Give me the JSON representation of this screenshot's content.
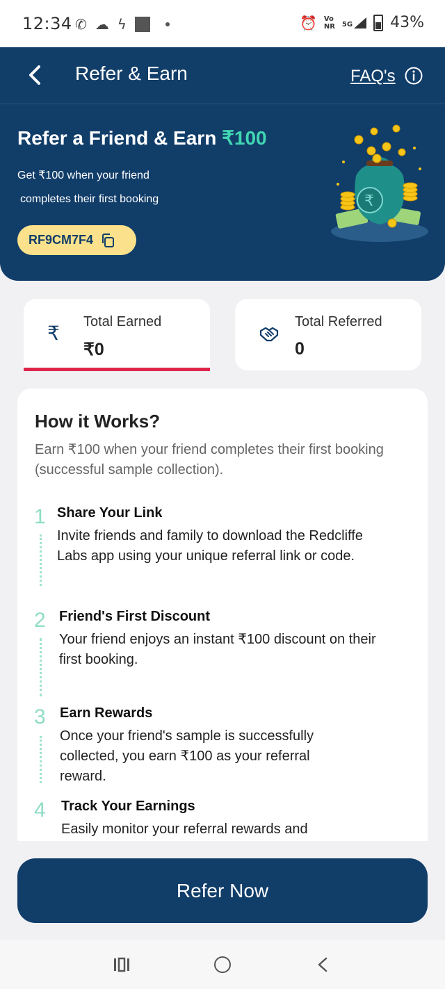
{
  "status_bar": {
    "time": "12:34",
    "network_top": "Vo",
    "network_bottom": "NR",
    "signal": "5G",
    "battery": "43%"
  },
  "header": {
    "title": "Refer & Earn",
    "faq_label": "FAQ's",
    "hero_title": "Refer a Friend & Earn ",
    "hero_amount": "₹100",
    "hero_line1": "Get ₹100 when your friend",
    "hero_line2": "completes their first booking",
    "referral_code": "RF9CM7F4"
  },
  "stats": {
    "earned_label": "Total Earned",
    "earned_value": "₹0",
    "earned_icon": "rupee-icon",
    "referred_label": "Total Referred",
    "referred_value": "0",
    "referred_icon": "handshake-icon"
  },
  "how_it_works": {
    "title": "How it Works?",
    "description": "Earn ₹100 when your friend completes their first booking (successful sample collection).",
    "steps": [
      {
        "number": "1",
        "title": "Share Your Link",
        "body": "Invite friends and family to download the Redcliffe Labs app using your unique referral link or code."
      },
      {
        "number": "2",
        "title": "Friend's First Discount",
        "body": "Your friend enjoys an instant ₹100 discount on their first booking."
      },
      {
        "number": "3",
        "title": "Earn Rewards",
        "body": "Once your friend's sample is successfully collected, you earn ₹100 as your referral reward."
      },
      {
        "number": "4",
        "title": "Track Your Earnings",
        "body": "Easily monitor your referral rewards and"
      }
    ]
  },
  "cta": {
    "label": "Refer Now"
  },
  "colors": {
    "primary": "#113d69",
    "accent": "#41d6b2",
    "code_bg": "#fbe18b",
    "active_tab": "#e0254b"
  }
}
